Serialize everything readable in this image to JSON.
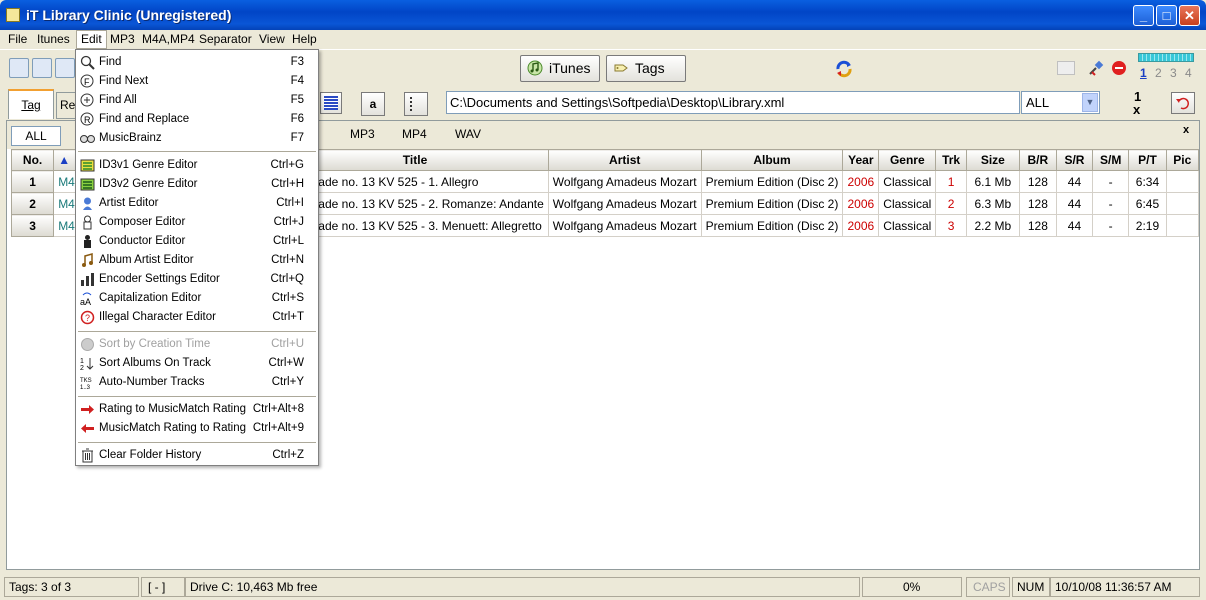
{
  "window": {
    "title": "iT Library Clinic (Unregistered)"
  },
  "menubar": [
    "File",
    "Itunes",
    "Edit",
    "MP3",
    "M4A,MP4",
    "Separator",
    "View",
    "Help"
  ],
  "toolbar": {
    "itunes_label": "iTunes",
    "tags_label": "Tags",
    "pages": [
      "1",
      "2",
      "3",
      "4"
    ],
    "active_page": "1"
  },
  "row2": {
    "tabs": [
      "Tag",
      "Ren"
    ],
    "a_label": "a",
    "path": "C:\\Documents and Settings\\Softpedia\\Desktop\\Library.xml",
    "filter": "ALL",
    "one_label": "1",
    "x_label": "x"
  },
  "filters": {
    "all": "ALL",
    "tabs": [
      "MP3",
      "MP4",
      "WAV"
    ],
    "close": "x"
  },
  "table": {
    "columns": [
      "No.",
      "",
      "Title",
      "Artist",
      "Album",
      "Year",
      "Genre",
      "Trk",
      "Size",
      "B/R",
      "S/R",
      "S/M",
      "P/T",
      "Pic"
    ],
    "rows": [
      {
        "no": "1",
        "type": "M4A",
        "title": "Serenade no. 13 KV 525 - 1. Allegro",
        "artist": "Wolfgang Amadeus Mozart",
        "album": "Premium Edition (Disc 2)",
        "year": "2006",
        "genre": "Classical",
        "trk": "1",
        "size": "6.1 Mb",
        "br": "128",
        "sr": "44",
        "sm": "-",
        "pt": "6:34",
        "pic": ""
      },
      {
        "no": "2",
        "type": "M4A",
        "title": "Serenade no. 13 KV 525 - 2. Romanze: Andante",
        "artist": "Wolfgang Amadeus Mozart",
        "album": "Premium Edition (Disc 2)",
        "year": "2006",
        "genre": "Classical",
        "trk": "2",
        "size": "6.3 Mb",
        "br": "128",
        "sr": "44",
        "sm": "-",
        "pt": "6:45",
        "pic": ""
      },
      {
        "no": "3",
        "type": "M4A",
        "title": "Serenade no. 13 KV 525 - 3. Menuett: Allegretto",
        "artist": "Wolfgang Amadeus Mozart",
        "album": "Premium Edition (Disc 2)",
        "year": "2006",
        "genre": "Classical",
        "trk": "3",
        "size": "2.2 Mb",
        "br": "128",
        "sr": "44",
        "sm": "-",
        "pt": "2:19",
        "pic": ""
      }
    ]
  },
  "edit_menu": {
    "items": [
      {
        "label": "Find",
        "shortcut": "F3",
        "icon": "magnifier-icon"
      },
      {
        "label": "Find Next",
        "shortcut": "F4",
        "icon": "find-next-icon"
      },
      {
        "label": "Find All",
        "shortcut": "F5",
        "icon": "find-all-icon"
      },
      {
        "label": "Find and Replace",
        "shortcut": "F6",
        "icon": "replace-icon"
      },
      {
        "label": "MusicBrainz",
        "shortcut": "F7",
        "icon": "musicbrainz-icon"
      },
      {
        "label": "ID3v1 Genre Editor",
        "shortcut": "Ctrl+G",
        "icon": "id3v1-icon"
      },
      {
        "label": "ID3v2 Genre Editor",
        "shortcut": "Ctrl+H",
        "icon": "id3v2-icon"
      },
      {
        "label": "Artist Editor",
        "shortcut": "Ctrl+I",
        "icon": "artist-icon"
      },
      {
        "label": "Composer Editor",
        "shortcut": "Ctrl+J",
        "icon": "composer-icon"
      },
      {
        "label": "Conductor Editor",
        "shortcut": "Ctrl+L",
        "icon": "conductor-icon"
      },
      {
        "label": "Album Artist Editor",
        "shortcut": "Ctrl+N",
        "icon": "album-artist-icon"
      },
      {
        "label": "Encoder Settings Editor",
        "shortcut": "Ctrl+Q",
        "icon": "encoder-icon"
      },
      {
        "label": "Capitalization Editor",
        "shortcut": "Ctrl+S",
        "icon": "capitalization-icon"
      },
      {
        "label": "Illegal Character Editor",
        "shortcut": "Ctrl+T",
        "icon": "illegal-char-icon"
      },
      {
        "label": "Sort by Creation Time",
        "shortcut": "Ctrl+U",
        "icon": "sort-time-icon"
      },
      {
        "label": "Sort Albums On Track",
        "shortcut": "Ctrl+W",
        "icon": "sort-albums-icon"
      },
      {
        "label": "Auto-Number Tracks",
        "shortcut": "Ctrl+Y",
        "icon": "auto-number-icon"
      },
      {
        "label": "Rating to MusicMatch Rating",
        "shortcut": "Ctrl+Alt+8",
        "icon": "arrow-right-icon"
      },
      {
        "label": "MusicMatch Rating to Rating",
        "shortcut": "Ctrl+Alt+9",
        "icon": "arrow-left-icon"
      },
      {
        "label": "Clear Folder History",
        "shortcut": "Ctrl+Z",
        "icon": "trash-icon"
      }
    ]
  },
  "status": {
    "tags": "Tags: 3 of 3",
    "brackets": "[ - ]",
    "drive": "Drive C: 10,463 Mb free",
    "percent": "0%",
    "caps": "CAPS",
    "num": "NUM",
    "datetime": "10/10/08 11:36:57 AM"
  }
}
